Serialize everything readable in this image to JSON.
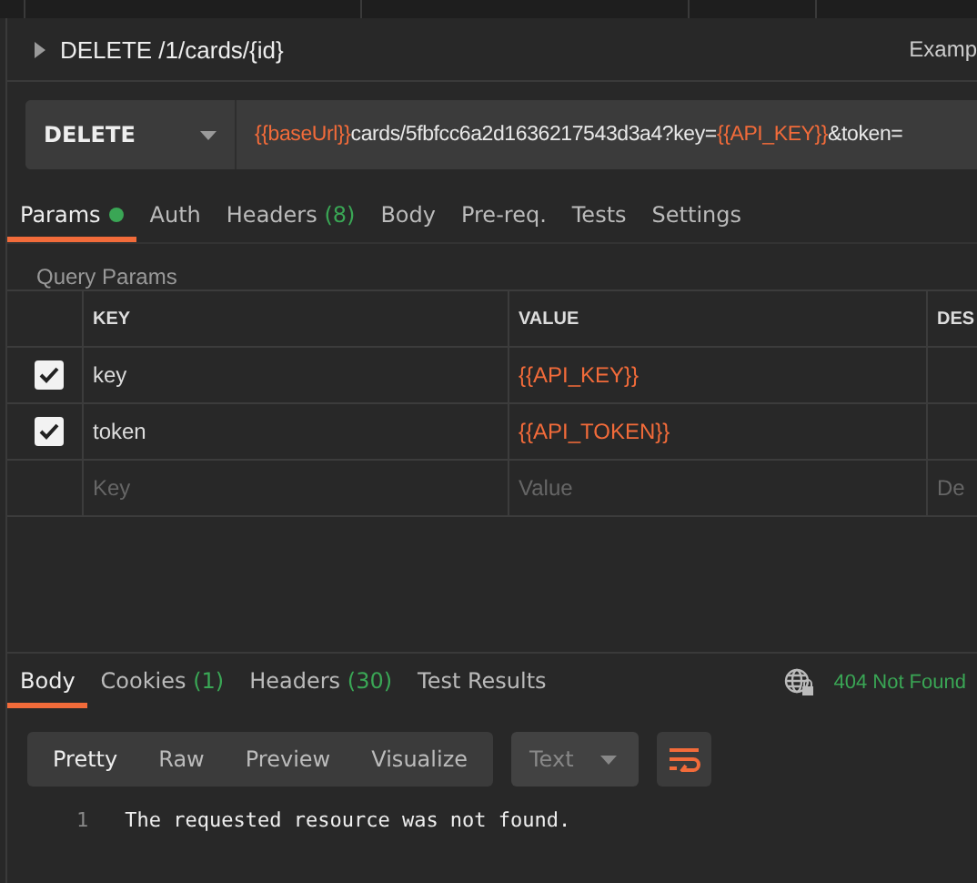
{
  "request": {
    "title": "DELETE /1/cards/{id}",
    "examples_label": "Examp",
    "method": "DELETE",
    "url": [
      {
        "kind": "var",
        "text": "{{baseUrl}}"
      },
      {
        "kind": "text",
        "text": "cards/5fbfcc6a2d1636217543d3a4?key="
      },
      {
        "kind": "var",
        "text": "{{API_KEY}}"
      },
      {
        "kind": "text",
        "text": "&token="
      }
    ]
  },
  "request_tabs": [
    {
      "label": "Params",
      "dot": true,
      "selected": true
    },
    {
      "label": "Auth",
      "dot": false,
      "selected": false
    },
    {
      "label": "Headers",
      "count": "(8)",
      "dot": false,
      "selected": false
    },
    {
      "label": "Body",
      "dot": false,
      "selected": false
    },
    {
      "label": "Pre-req.",
      "dot": false,
      "selected": false
    },
    {
      "label": "Tests",
      "dot": false,
      "selected": false
    },
    {
      "label": "Settings",
      "dot": false,
      "selected": false
    }
  ],
  "query_params": {
    "title": "Query Params",
    "columns": [
      "KEY",
      "VALUE",
      "DES"
    ],
    "rows": [
      {
        "checked": true,
        "key": "key",
        "value": "{{API_KEY}}"
      },
      {
        "checked": true,
        "key": "token",
        "value": "{{API_TOKEN}}"
      }
    ],
    "placeholders": [
      "Key",
      "Value",
      "De"
    ]
  },
  "response_tabs": [
    {
      "label": "Body",
      "selected": true
    },
    {
      "label": "Cookies",
      "count": "(1)",
      "selected": false
    },
    {
      "label": "Headers",
      "count": "(30)",
      "selected": false
    },
    {
      "label": "Test Results",
      "selected": false
    }
  ],
  "status": "404 Not Found",
  "view_modes": [
    {
      "label": "Pretty",
      "selected": true
    },
    {
      "label": "Raw",
      "selected": false
    },
    {
      "label": "Preview",
      "selected": false
    },
    {
      "label": "Visualize",
      "selected": false
    }
  ],
  "format": "Text",
  "body_lines": [
    {
      "number": "1",
      "text": "The requested resource was not found."
    }
  ]
}
